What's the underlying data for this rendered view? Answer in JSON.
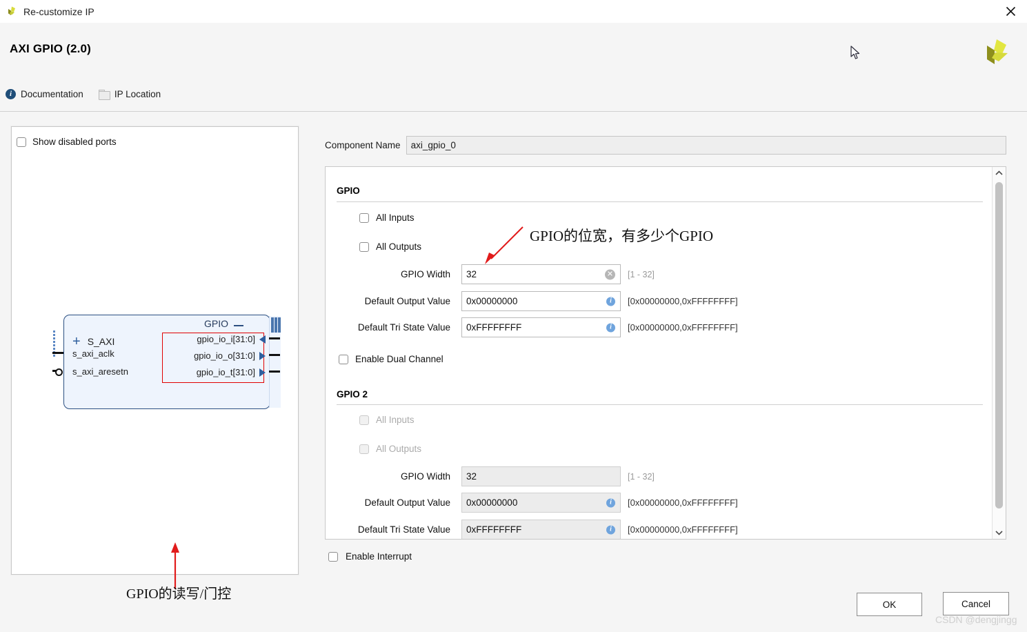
{
  "window": {
    "title": "Re-customize IP",
    "app_icon": "vivado-logo-icon",
    "close_icon": "close-icon"
  },
  "header": {
    "page_title": "AXI GPIO (2.0)",
    "links": [
      {
        "label": "Documentation",
        "icon": "info-icon"
      },
      {
        "label": "IP Location",
        "icon": "folder-icon"
      }
    ],
    "brand_logo": "xilinx-logo-icon"
  },
  "diagram": {
    "show_disabled_ports": {
      "label": "Show disabled ports",
      "checked": false
    },
    "block": {
      "interface_label": "GPIO",
      "bus_label": "S_AXI",
      "left_ports": [
        "s_axi_aclk",
        "s_axi_aresetn"
      ],
      "right_ports": [
        {
          "name": "gpio_io_i[31:0]",
          "direction": "in"
        },
        {
          "name": "gpio_io_o[31:0]",
          "direction": "out"
        },
        {
          "name": "gpio_io_t[31:0]",
          "direction": "out"
        }
      ]
    },
    "annotation": "GPIO的读写/门控"
  },
  "component_name": {
    "label": "Component Name",
    "value": "axi_gpio_0"
  },
  "annotation_width": "GPIO的位宽，有多少个GPIO",
  "sections": [
    {
      "title": "GPIO",
      "disabled": false,
      "checkboxes": [
        {
          "label": "All Inputs",
          "checked": false
        },
        {
          "label": "All Outputs",
          "checked": false
        }
      ],
      "fields": [
        {
          "label": "GPIO Width",
          "value": "32",
          "hint": "[1 - 32]",
          "trailing_icon": "clear-icon"
        },
        {
          "label": "Default Output Value",
          "value": "0x00000000",
          "hint": "[0x00000000,0xFFFFFFFF]",
          "trailing_icon": "info-icon"
        },
        {
          "label": "Default Tri State Value",
          "value": "0xFFFFFFFF",
          "hint": "[0x00000000,0xFFFFFFFF]",
          "trailing_icon": "info-icon"
        }
      ]
    },
    {
      "title": "GPIO 2",
      "disabled": true,
      "checkboxes": [
        {
          "label": "All Inputs",
          "checked": false
        },
        {
          "label": "All Outputs",
          "checked": false
        }
      ],
      "fields": [
        {
          "label": "GPIO Width",
          "value": "32",
          "hint": "[1 - 32]",
          "trailing_icon": "none"
        },
        {
          "label": "Default Output Value",
          "value": "0x00000000",
          "hint": "[0x00000000,0xFFFFFFFF]",
          "trailing_icon": "info-icon"
        },
        {
          "label": "Default Tri State Value",
          "value": "0xFFFFFFFF",
          "hint": "[0x00000000,0xFFFFFFFF]",
          "trailing_icon": "info-icon"
        }
      ]
    }
  ],
  "enable_dual_channel": {
    "label": "Enable Dual Channel",
    "checked": false
  },
  "enable_interrupt": {
    "label": "Enable Interrupt",
    "checked": false
  },
  "footer": {
    "ok_label": "OK",
    "cancel_label": "Cancel"
  },
  "watermark": "CSDN @dengjingg",
  "colors": {
    "accent_blue": "#2b4f81",
    "block_fill": "#eef4fd",
    "highlight_red": "#e00000",
    "info_blue": "#6fa4dd",
    "brand_yellow": "#d6d82a",
    "brand_olive": "#8b8b1e"
  }
}
